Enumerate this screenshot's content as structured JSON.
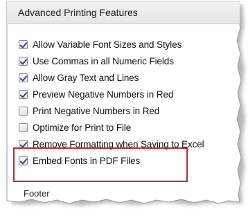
{
  "panel": {
    "title": "Advanced Printing Features",
    "options": [
      {
        "label": "Allow Variable Font Sizes and Styles",
        "checked": true
      },
      {
        "label": "Use Commas in all Numeric Fields",
        "checked": true
      },
      {
        "label": "Allow Gray Text and Lines",
        "checked": true
      },
      {
        "label": "Preview Negative Numbers in Red",
        "checked": true
      },
      {
        "label": "Print Negative Numbers in Red",
        "checked": false
      },
      {
        "label": "Optimize for Print to File",
        "checked": false
      },
      {
        "label": "Remove Formatting when Saving to Excel",
        "checked": true
      },
      {
        "label": "Embed Fonts in PDF Files",
        "checked": true
      }
    ],
    "footer_label": "Footer"
  },
  "colors": {
    "highlight": "#c42a2a",
    "checkmark": "#2a4f86",
    "header_bg": "#eeeeee"
  }
}
